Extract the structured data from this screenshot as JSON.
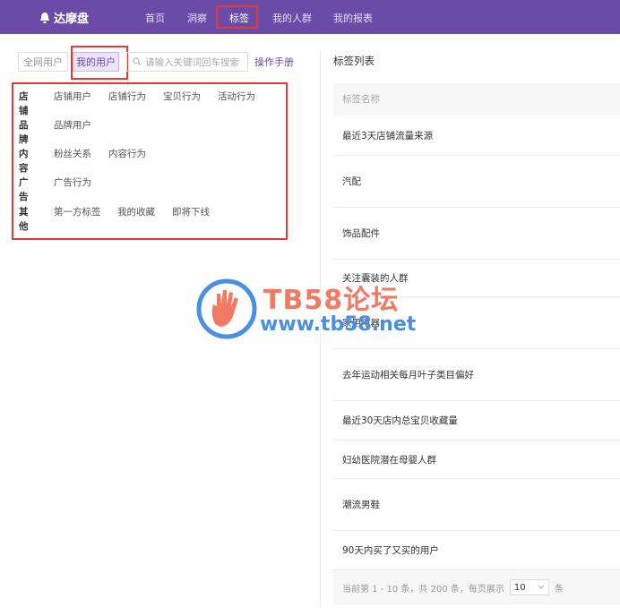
{
  "app": {
    "name": "达摩盘"
  },
  "nav": {
    "items": [
      {
        "label": "首页"
      },
      {
        "label": "洞察"
      },
      {
        "label": "标签",
        "active": true
      },
      {
        "label": "我的人群"
      },
      {
        "label": "我的报表"
      }
    ]
  },
  "filters": {
    "scope_all": "全网用户",
    "scope_mine": "我的用户",
    "search_placeholder": "请输入关键词回车搜索",
    "manual_link": "操作手册"
  },
  "categories": [
    {
      "label": "店铺",
      "options": [
        "店铺用户",
        "店铺行为",
        "宝贝行为",
        "活动行为"
      ]
    },
    {
      "label": "品牌",
      "options": [
        "品牌用户"
      ]
    },
    {
      "label": "内容",
      "options": [
        "粉丝关系",
        "内容行为"
      ]
    },
    {
      "label": "广告",
      "options": [
        "广告行为"
      ]
    },
    {
      "label": "其他",
      "options": [
        "第一方标签",
        "我的收藏",
        "即将下线"
      ]
    }
  ],
  "tag_list": {
    "title": "标签列表",
    "column_header": "标签名称",
    "rows": [
      "最近3天店铺流量来源",
      "汽配",
      "饰品配件",
      "关注囊装的人群",
      "家用电器",
      "去年运动相关每月叶子类目偏好",
      "最近30天店内总宝贝收藏量",
      "妇幼医院潜在母婴人群",
      "潮流男鞋",
      "90天内买了又买的用户"
    ],
    "pagination": {
      "summary": "当前第 1 - 10 条，共 200 条，每页展示",
      "page_size": "10",
      "unit": "条"
    }
  },
  "watermark": {
    "title": "TB58论坛",
    "url": "www.tb58.net"
  },
  "colors": {
    "brand": "#6a4ba8",
    "highlight_border": "#e53935",
    "watermark_red": "#f07a63",
    "watermark_blue": "#4a90e2"
  }
}
